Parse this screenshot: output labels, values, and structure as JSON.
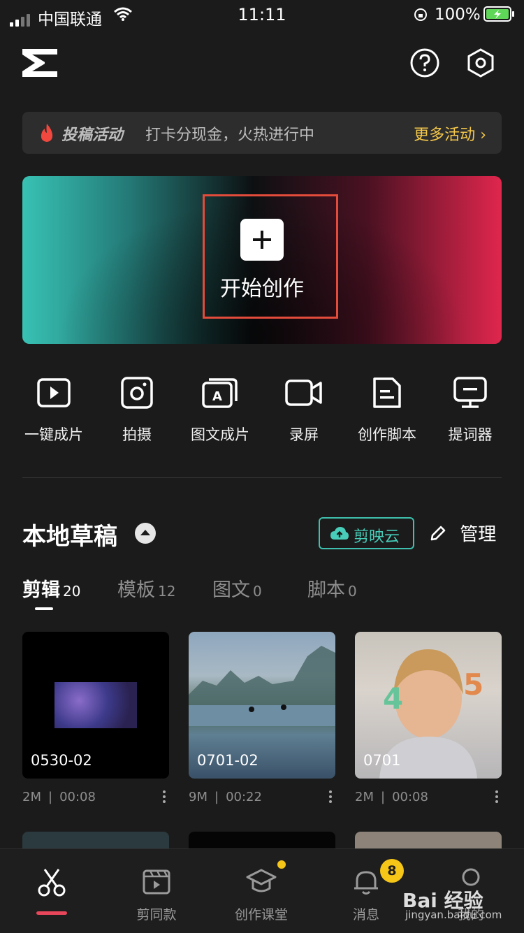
{
  "status_bar": {
    "carrier": "中国联通",
    "time": "11:11",
    "battery": "100%"
  },
  "banner": {
    "tag": "投稿活动",
    "text": "打卡分现金，火热进行中",
    "more": "更多活动"
  },
  "hero": {
    "label": "开始创作"
  },
  "tools": [
    {
      "label": "一键成片",
      "icon": "play-box-icon"
    },
    {
      "label": "拍摄",
      "icon": "camera-icon"
    },
    {
      "label": "图文成片",
      "icon": "text-image-icon"
    },
    {
      "label": "录屏",
      "icon": "video-record-icon"
    },
    {
      "label": "创作脚本",
      "icon": "script-doc-icon"
    },
    {
      "label": "提词器",
      "icon": "teleprompter-icon"
    }
  ],
  "drafts": {
    "title": "本地草稿",
    "cloud": "剪映云",
    "manage": "管理",
    "tabs": [
      {
        "label": "剪辑",
        "count": "20"
      },
      {
        "label": "模板",
        "count": "12"
      },
      {
        "label": "图文",
        "count": "0"
      },
      {
        "label": "脚本",
        "count": "0"
      }
    ],
    "items": [
      {
        "name": "0530-02",
        "size": "2M",
        "duration": "00:08"
      },
      {
        "name": "0701-02",
        "size": "9M",
        "duration": "00:22"
      },
      {
        "name": "0701",
        "size": "2M",
        "duration": "00:08"
      }
    ]
  },
  "nav": {
    "items": [
      {
        "label": ""
      },
      {
        "label": "剪同款"
      },
      {
        "label": "创作课堂"
      },
      {
        "label": "消息"
      },
      {
        "label": "我的"
      }
    ],
    "badge": "8"
  },
  "watermark": {
    "main": "Bai 经验",
    "sub": "jingyan.baidu.com"
  }
}
